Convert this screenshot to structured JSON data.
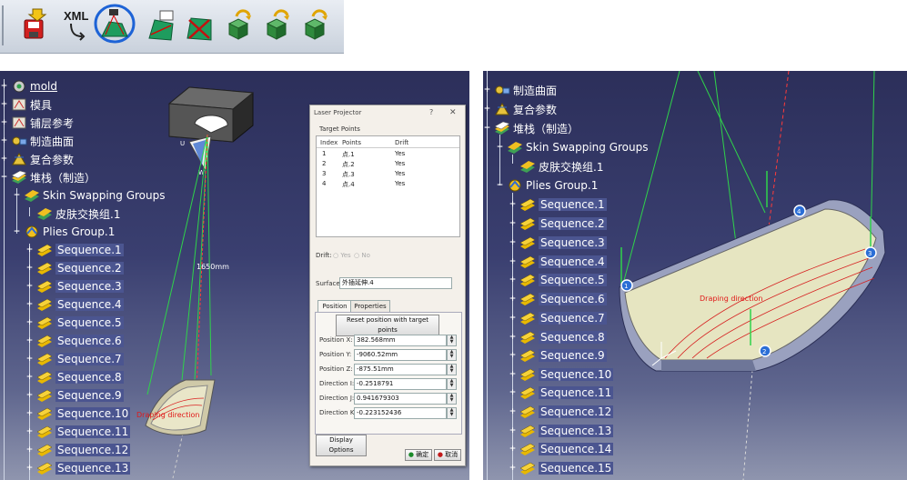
{
  "toolbar": {
    "buttons": [
      {
        "icon": "save-red-disk-icon"
      },
      {
        "icon": "xml-export-icon",
        "label": "XML"
      },
      {
        "icon": "laser-projector-icon",
        "selected": true
      },
      {
        "icon": "ply-export-icon"
      },
      {
        "icon": "flatten-export-icon"
      },
      {
        "icon": "cube-arrow-export-icon"
      },
      {
        "icon": "cube-arrow-export-icon"
      },
      {
        "icon": "cube-arrow-export-icon"
      }
    ],
    "highlight_color": "#1d63d6"
  },
  "left_tree": [
    {
      "label": "mold",
      "underline": true
    },
    {
      "label": "模具"
    },
    {
      "label": "铺层参考"
    },
    {
      "label": "制造曲面"
    },
    {
      "label": "复合参数"
    },
    {
      "label": "堆栈（制造）"
    },
    {
      "label": "Skin Swapping Groups"
    },
    {
      "label": "皮肤交换组.1"
    },
    {
      "label": "Plies Group.1"
    },
    {
      "label": "Sequence.1"
    },
    {
      "label": "Sequence.2"
    },
    {
      "label": "Sequence.3"
    },
    {
      "label": "Sequence.4"
    },
    {
      "label": "Sequence.5"
    },
    {
      "label": "Sequence.6"
    },
    {
      "label": "Sequence.7"
    },
    {
      "label": "Sequence.8"
    },
    {
      "label": "Sequence.9"
    },
    {
      "label": "Sequence.10"
    },
    {
      "label": "Sequence.11"
    },
    {
      "label": "Sequence.12"
    },
    {
      "label": "Sequence.13"
    }
  ],
  "right_tree": [
    {
      "label": "制造曲面"
    },
    {
      "label": "复合参数"
    },
    {
      "label": "堆栈（制造）"
    },
    {
      "label": "Skin Swapping Groups"
    },
    {
      "label": "皮肤交换组.1"
    },
    {
      "label": "Plies Group.1"
    },
    {
      "label": "Sequence.1"
    },
    {
      "label": "Sequence.2"
    },
    {
      "label": "Sequence.3"
    },
    {
      "label": "Sequence.4"
    },
    {
      "label": "Sequence.5"
    },
    {
      "label": "Sequence.6"
    },
    {
      "label": "Sequence.7"
    },
    {
      "label": "Sequence.8"
    },
    {
      "label": "Sequence.9"
    },
    {
      "label": "Sequence.10"
    },
    {
      "label": "Sequence.11"
    },
    {
      "label": "Sequence.12"
    },
    {
      "label": "Sequence.13"
    },
    {
      "label": "Sequence.14"
    },
    {
      "label": "Sequence.15"
    }
  ],
  "left_model": {
    "distance_label": "1650mm",
    "draping_label": "Draping direction",
    "axis_u": "U",
    "axis_w": "W"
  },
  "right_model": {
    "draping_label": "Draping direction",
    "markers": [
      "1",
      "2",
      "3",
      "4"
    ]
  },
  "dialog": {
    "title": "Laser Projector",
    "help": "?",
    "close": "✕",
    "target_points_title": "Target Points",
    "columns": [
      "Index",
      "Points",
      "Drift"
    ],
    "rows": [
      [
        "1",
        "点.1",
        "Yes"
      ],
      [
        "2",
        "点.2",
        "Yes"
      ],
      [
        "3",
        "点.3",
        "Yes"
      ],
      [
        "4",
        "点.4",
        "Yes"
      ]
    ],
    "drift_label": "Drift:",
    "drift_yes": "Yes",
    "drift_no": "No",
    "surface_label": "Surface:",
    "surface_value": "外插延伸.4",
    "tabs": [
      "Position",
      "Properties"
    ],
    "reset_button": "Reset position with target points",
    "fields": [
      {
        "label": "Position X:",
        "value": "382.568mm"
      },
      {
        "label": "Position Y:",
        "value": "-9060.52mm"
      },
      {
        "label": "Position Z:",
        "value": "-875.51mm"
      },
      {
        "label": "Direction I:",
        "value": "-0.2518791"
      },
      {
        "label": "Direction J:",
        "value": "0.941679303"
      },
      {
        "label": "Direction K:",
        "value": "-0.223152436"
      }
    ],
    "display_options": "Display Options",
    "ok": "确定",
    "cancel": "取消"
  }
}
